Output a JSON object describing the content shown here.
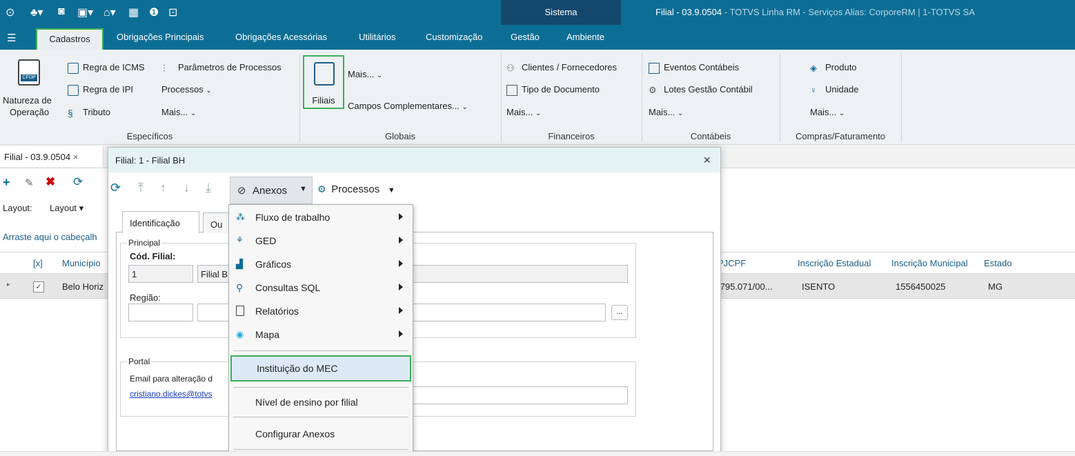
{
  "titlebar": {
    "sistema": "Sistema",
    "app_title_main": "Filial - 03.9.0504",
    "app_title_rest": " - TOTVS Linha RM - Serviços  Alias: CorporeRM | 1-TOTVS SA"
  },
  "menubar": {
    "items": [
      "Cadastros",
      "Obrigações Principais",
      "Obrigações Acessórias",
      "Utilitários",
      "Customização",
      "Gestão",
      "Ambiente"
    ]
  },
  "ribbon": {
    "especificos": {
      "natureza_line1": "Natureza de",
      "natureza_line2": "Operação",
      "cfop_badge": "CFOP",
      "regra_icms": "Regra de ICMS",
      "regra_ipi": "Regra de IPI",
      "tributo": "Tributo",
      "parametros": "Parâmetros de Processos",
      "processos": "Processos",
      "mais": "Mais...",
      "group_label": "Específicos"
    },
    "globais": {
      "filiais": "Filiais",
      "mais": "Mais...",
      "campos": "Campos Complementares...",
      "group_label": "Globais"
    },
    "financeiros": {
      "clientes": "Clientes / Fornecedores",
      "tipo_doc": "Tipo de Documento",
      "mais": "Mais...",
      "group_label": "Financeiros"
    },
    "contabeis": {
      "eventos": "Eventos Contábeis",
      "lotes": "Lotes Gestão Contábil",
      "mais": "Mais...",
      "group_label": "Contábeis"
    },
    "compras": {
      "produto": "Produto",
      "unidade": "Unidade",
      "mais": "Mais...",
      "group_label": "Compras/Faturamento"
    }
  },
  "doc_tab": {
    "label": "Filial - 03.9.0504",
    "close": "×"
  },
  "back_view": {
    "layout_label": "Layout:",
    "layout_btn": "Layout",
    "drag_hint": "Arraste aqui o cabeçalh",
    "columns": [
      "[x]",
      "Município",
      "PJCPF",
      "Inscrição Estadual",
      "Inscrição Municipal",
      "Estado"
    ],
    "row": {
      "municipio": "Belo Horiz",
      "cnpj": ".795.071/00...",
      "ie": "ISENTO",
      "im": "1556450025",
      "estado": "MG"
    }
  },
  "dialog": {
    "title": "Filial: 1 - Filial BH",
    "close": "×",
    "anexos": "Anexos",
    "processos": "Processos",
    "tabs": [
      "Identificação",
      "Ou"
    ],
    "principal_legend": "Principal",
    "cod_filial_label": "Cód. Filial:",
    "cod_filial_value": "1",
    "nome_value": "Filial B",
    "regiao_label": "Região:",
    "ellipsis": "...",
    "portal_legend": "Portal",
    "email_label": "Email para alteração d",
    "email_link": "cristiano.dickes@totvs"
  },
  "dropdown": {
    "items": [
      {
        "label": "Fluxo de trabalho",
        "icon": "workflow-icon"
      },
      {
        "label": "GED",
        "icon": "ged-icon"
      },
      {
        "label": "Gráficos",
        "icon": "chart-icon"
      },
      {
        "label": "Consultas SQL",
        "icon": "search-icon"
      },
      {
        "label": "Relatórios",
        "icon": "report-icon"
      },
      {
        "label": "Mapa",
        "icon": "map-pin-icon"
      }
    ],
    "mec": "Instituição do MEC",
    "nivel": "Nível de ensino por filial",
    "configurar": "Configurar Anexos"
  },
  "colors": {
    "titlebar": "#0d6e95",
    "sistema": "#13476b",
    "highlight": "#3dae57"
  }
}
